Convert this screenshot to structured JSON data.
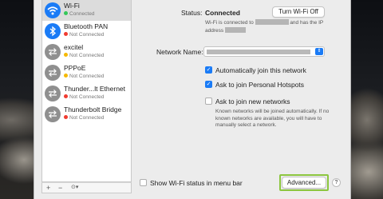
{
  "services": [
    {
      "name": "Wi-Fi",
      "status": "Connected",
      "status_color": "#34c759",
      "icon": "wifi-icon",
      "selected": true
    },
    {
      "name": "Bluetooth PAN",
      "status": "Not Connected",
      "status_color": "#f03b30",
      "icon": "bluetooth-icon"
    },
    {
      "name": "excitel",
      "status": "Not Connected",
      "status_color": "#f5b800",
      "icon": "network-arrows-icon"
    },
    {
      "name": "PPPoE",
      "status": "Not Connected",
      "status_color": "#f5b800",
      "icon": "network-arrows-icon"
    },
    {
      "name": "Thunder...lt Ethernet",
      "status": "Not Connected",
      "status_color": "#f03b30",
      "icon": "network-arrows-icon"
    },
    {
      "name": "Thunderbolt Bridge",
      "status": "Not Connected",
      "status_color": "#f03b30",
      "icon": "network-arrows-icon"
    }
  ],
  "sidebar_toolbar": {
    "add": "+",
    "remove": "−",
    "action": "⊙▾"
  },
  "status": {
    "label": "Status:",
    "value": "Connected",
    "toggle_button": "Turn Wi-Fi Off",
    "detail_part1": "Wi-Fi is connected to",
    "detail_part2": "and has the IP address"
  },
  "network_name": {
    "label": "Network Name:",
    "stepper": "⇕"
  },
  "options": {
    "auto_join": {
      "label": "Automatically join this network",
      "checked": true
    },
    "personal_hotspots": {
      "label": "Ask to join Personal Hotspots",
      "checked": true
    },
    "new_networks": {
      "label": "Ask to join new networks",
      "checked": false,
      "description": "Known networks will be joined automatically. If no known networks are available, you will have to manually select a network."
    }
  },
  "menu_bar_status": {
    "label": "Show Wi-Fi status in menu bar",
    "checked": false
  },
  "advanced_button": "Advanced...",
  "help": "?",
  "accent_color": "#1a7bf6"
}
